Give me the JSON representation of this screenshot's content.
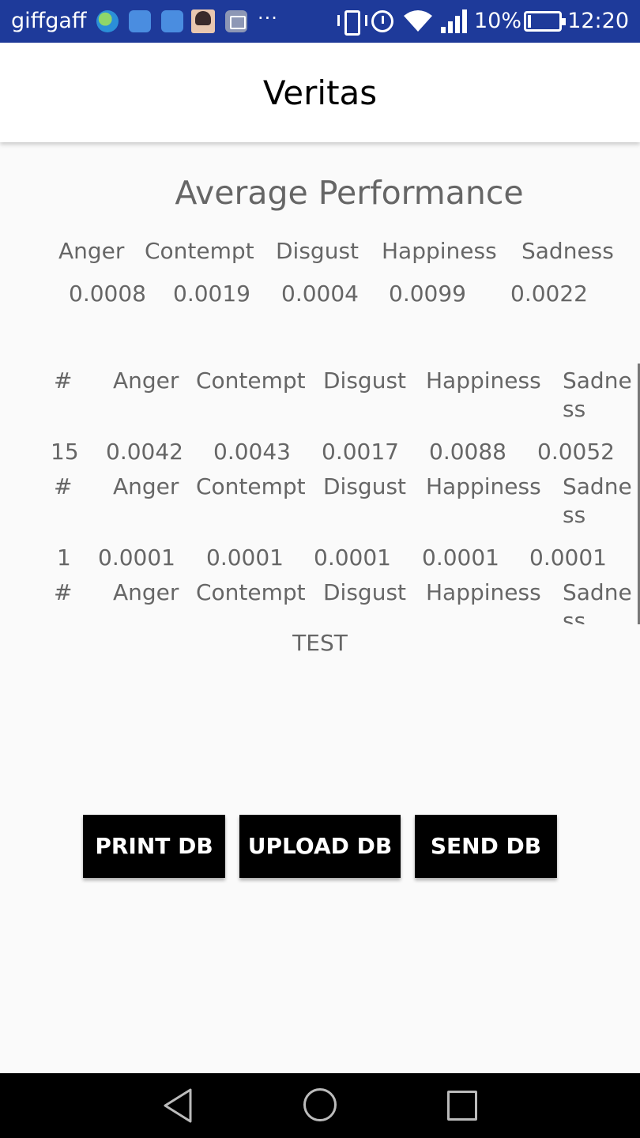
{
  "status_bar": {
    "carrier": "giffgaff",
    "more": "···",
    "battery_percent": "10%",
    "battery_level": 0.1,
    "time": "12:20",
    "notification_icons": [
      "globe-icon",
      "heart-monitor-icon",
      "usb-icon",
      "avatar-icon",
      "gallery-icon"
    ],
    "status_icons": [
      "vibrate-icon",
      "alarm-icon",
      "wifi-icon",
      "signal-icon",
      "battery-charging-icon"
    ]
  },
  "app_bar": {
    "title": "Veritas"
  },
  "average": {
    "title": "Average Performance",
    "headers": [
      "Anger",
      "Contempt",
      "Disgust",
      "Happiness",
      "Sadness"
    ],
    "values": [
      "0.0008",
      "0.0019",
      "0.0004",
      "0.0099",
      "0.0022"
    ]
  },
  "records": {
    "header": {
      "num": "#",
      "anger": "Anger",
      "contempt": "Contempt",
      "disgust": "Disgust",
      "happiness": "Happiness",
      "sadness": "Sadness"
    },
    "rows": [
      {
        "num": "15",
        "anger": "0.0042",
        "contempt": "0.0043",
        "disgust": "0.0017",
        "happiness": "0.0088",
        "sadness": "0.0052"
      },
      {
        "num": "1",
        "anger": "0.0001",
        "contempt": "0.0001",
        "disgust": "0.0001",
        "happiness": "0.0001",
        "sadness": "0.0001"
      }
    ]
  },
  "test_label": "TEST",
  "buttons": {
    "print": "PRINT DB",
    "upload": "UPLOAD DB",
    "send": "SEND DB"
  },
  "nav": {
    "icons": [
      "back-icon",
      "home-icon",
      "recents-icon"
    ]
  },
  "colors": {
    "status_bar": "#1e3a9a",
    "button_bg": "#000000",
    "button_text": "#ffffff",
    "text_gray": "#666666"
  }
}
